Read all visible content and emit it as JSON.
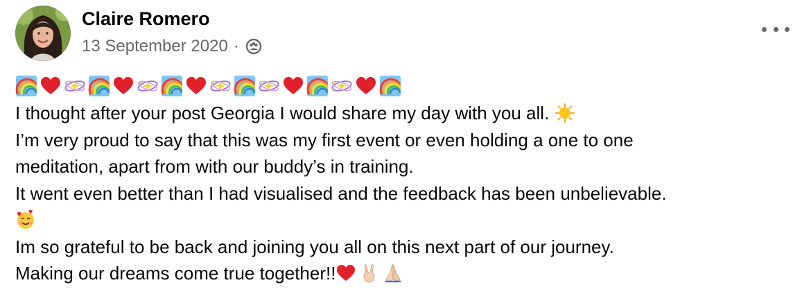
{
  "post": {
    "author": "Claire Romero",
    "date": "13 September 2020",
    "separator": "·",
    "audience_icon": "friends-icon",
    "more_icon": "more-options-icon",
    "emoji_row": [
      "rainbow",
      "heart",
      "sparkle-orbit",
      "rainbow",
      "heart",
      "sparkle-orbit",
      "rainbow",
      "heart",
      "sparkle-orbit",
      "rainbow",
      "sparkle-orbit",
      "heart",
      "rainbow",
      "sparkle-orbit",
      "heart",
      "rainbow"
    ],
    "lines": {
      "l1": "I thought after your post Georgia I would share my day with you all.",
      "l2": "I’m very proud to say that this was my first event or even holding a one to one",
      "l3": "meditation,  apart from with our buddy’s in training.",
      "l4": "It went even better than I had visualised and the feedback has been unbelievable.",
      "l6": "Im so grateful to be back and joining you all on this next part of our journey.",
      "l7": "Making our dreams come true together!!"
    },
    "inline_emoji": {
      "l1_end": "sun",
      "l5": "smiling-face-with-hearts",
      "l7_end": [
        "heart",
        "victory-hand",
        "folded-hands"
      ]
    }
  },
  "colors": {
    "text": "#050505",
    "secondary": "#65676b",
    "heart": "#e0202a"
  }
}
